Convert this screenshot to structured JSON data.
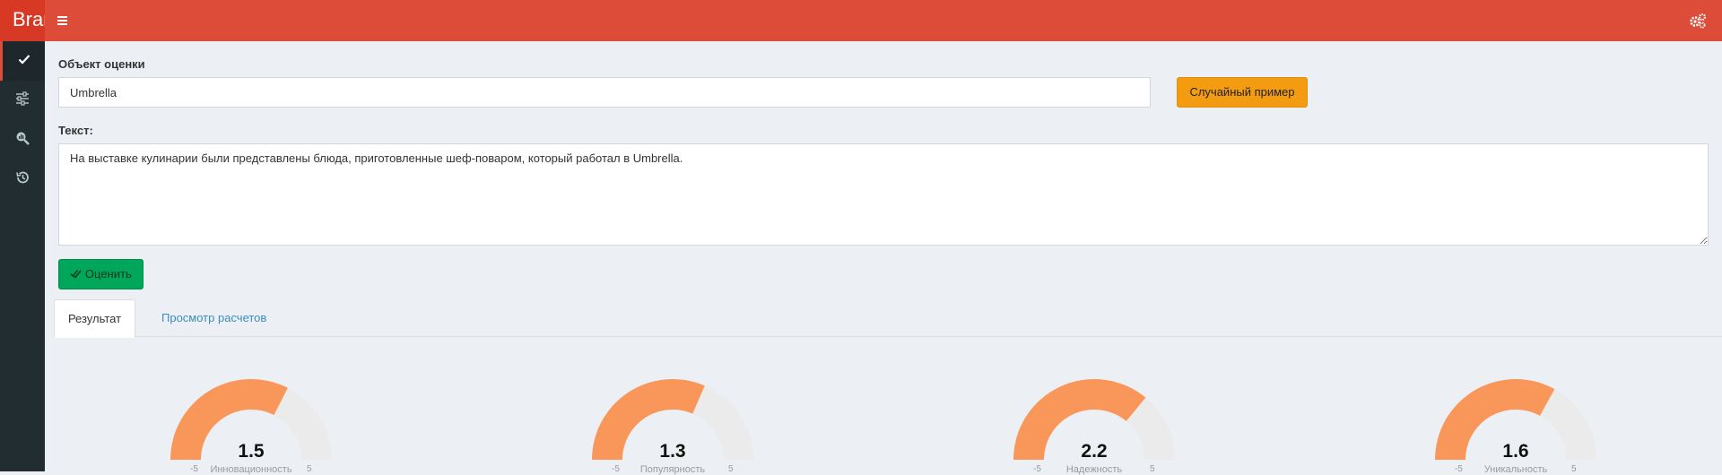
{
  "header": {
    "brand": "Brand",
    "menu_icon": "hamburger-icon",
    "settings_icon": "gears-icon",
    "accent_color": "#dd4b39"
  },
  "sidebar": {
    "items": [
      {
        "icon": "check-icon",
        "active": true
      },
      {
        "icon": "sliders-icon",
        "active": false
      },
      {
        "icon": "search-analytics-icon",
        "active": false
      },
      {
        "icon": "history-icon",
        "active": false
      }
    ]
  },
  "form": {
    "object_label": "Объект оценки",
    "object_value": "Umbrella",
    "random_button": "Случайный пример",
    "text_label": "Текст:",
    "text_value": "На выставке кулинарии были представлены блюда, приготовленные шеф-поваром, который работал в Umbrella.",
    "evaluate_button": "Оценить"
  },
  "tabs": [
    {
      "label": "Результат",
      "active": true
    },
    {
      "label": "Просмотр расчетов",
      "active": false
    }
  ],
  "gauges": [
    {
      "value": 1.5,
      "value_text": "1.5",
      "label": "Инновационность",
      "min": -5,
      "max": 5,
      "min_text": "-5",
      "max_text": "5"
    },
    {
      "value": 1.3,
      "value_text": "1.3",
      "label": "Популярность",
      "min": -5,
      "max": 5,
      "min_text": "-5",
      "max_text": "5"
    },
    {
      "value": 2.2,
      "value_text": "2.2",
      "label": "Надежность",
      "min": -5,
      "max": 5,
      "min_text": "-5",
      "max_text": "5"
    },
    {
      "value": 1.6,
      "value_text": "1.6",
      "label": "Уникальность",
      "min": -5,
      "max": 5,
      "min_text": "-5",
      "max_text": "5"
    }
  ],
  "gauge_colors": {
    "fill": "#f9965a",
    "track": "#ebebeb"
  }
}
